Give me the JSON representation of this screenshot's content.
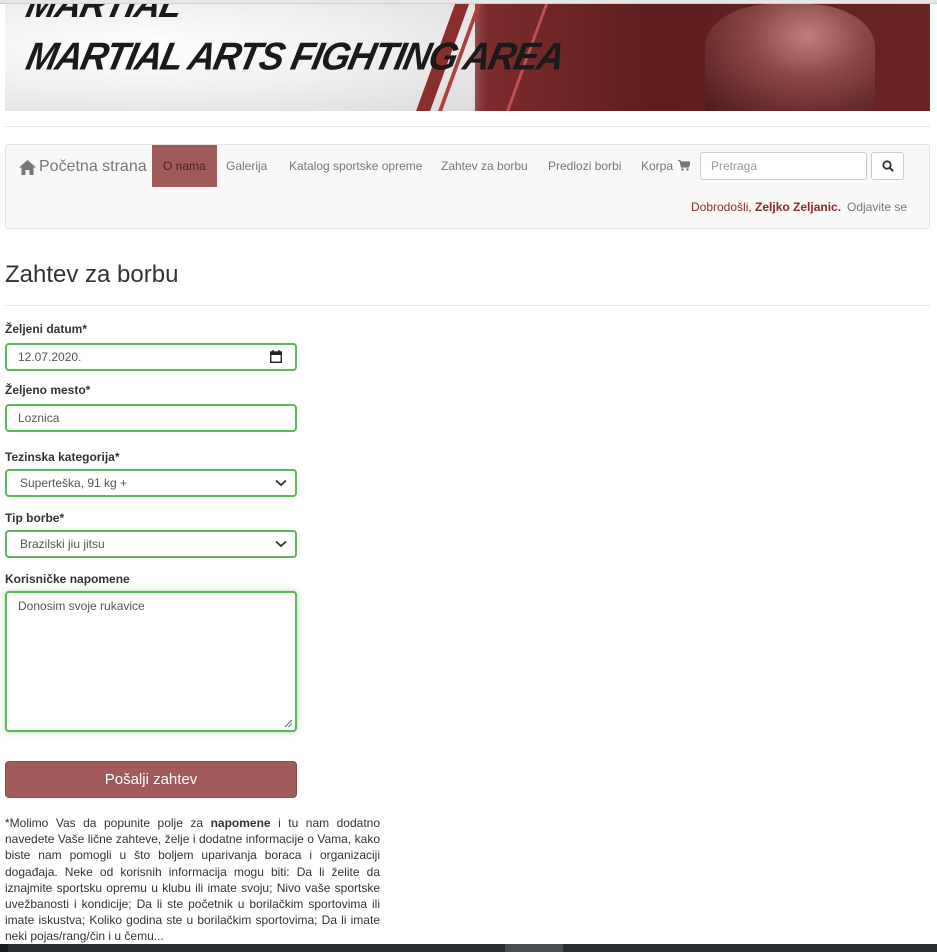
{
  "banner": {
    "title_top": "MARTIAL",
    "title": "MARTIAL ARTS FIGHTING AREA"
  },
  "navbar": {
    "home_label": "Početna strana",
    "items": [
      {
        "label": "O nama",
        "active": true
      },
      {
        "label": "Galerija",
        "active": false
      },
      {
        "label": "Katalog sportske opreme",
        "active": false
      },
      {
        "label": "Zahtev za borbu",
        "active": false
      },
      {
        "label": "Predlozi borbi",
        "active": false
      },
      {
        "label": "Korpa",
        "active": false
      }
    ],
    "search_placeholder": "Pretraga",
    "welcome_prefix": "Dobrodošli, ",
    "user_name": "Zeljko Zeljanic.",
    "logout_label": "Odjavite se"
  },
  "page": {
    "title": "Zahtev za borbu"
  },
  "form": {
    "date_label": "Željeni datum*",
    "date_value": "12.07.2020.",
    "place_label": "Željeno mesto*",
    "place_value": "Loznica",
    "weight_label": "Tezinska kategorija*",
    "weight_value": "Superteška, 91 kg +",
    "fight_type_label": "Tip borbe*",
    "fight_type_value": "Brazilski jiu jitsu",
    "notes_label": "Korisničke napomene",
    "notes_value": "Donosim svoje rukavice",
    "submit_label": "Pošalji zahtev"
  },
  "note": {
    "part1": "*Molimo Vas da popunite polje za ",
    "bold": "napomene",
    "part2": " i tu nam dodatno navedete Vaše lične zahteve, želje i dodatne informacije o Vama, kako biste nam pomogli u što boljem uparivanja boraca i organizaciji događaja. Neke od korisnih informacija mogu biti: Da li želite da iznajmite sportsku opremu u klubu ili imate svoju; Nivo vaše sportske uvežbanosti i kondicije; Da li ste početnik u borilačkim sportovima ili imate iskustva; Koliko godina ste u borilačkim sportovima; Da li imate neki pojas/rang/čin i u čemu..."
  },
  "colors": {
    "accent": "#a15a5a",
    "field_border": "#5cb85c",
    "welcome_text": "#8b2c2c"
  },
  "icons": {
    "home": "home-icon",
    "cart": "cart-icon",
    "search": "search-icon",
    "calendar": "calendar-icon",
    "chevron": "chevron-down-icon"
  }
}
